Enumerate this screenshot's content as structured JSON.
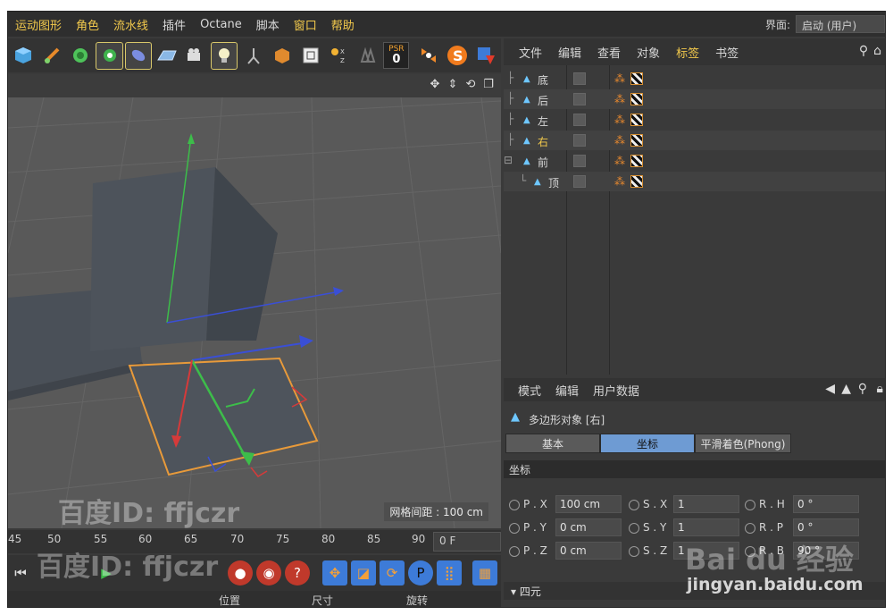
{
  "menubar": {
    "items": [
      "运动图形",
      "角色",
      "流水线",
      "插件",
      "Octane",
      "脚本",
      "窗口",
      "帮助"
    ],
    "layout_label": "界面:",
    "layout_value": "启动 (用户)"
  },
  "toolbar": {
    "psr_top": "PSR",
    "psr_bottom": "0"
  },
  "viewport": {
    "grid_info": "网格间距 : 100 cm"
  },
  "timeline": {
    "ticks": [
      "45",
      "50",
      "55",
      "60",
      "65",
      "70",
      "75",
      "80",
      "85",
      "90"
    ],
    "current_frame": "0 F"
  },
  "bottom_bar": {
    "position": "位置",
    "size": "尺寸",
    "rotation": "旋转"
  },
  "object_manager": {
    "menu": [
      "文件",
      "编辑",
      "查看",
      "对象",
      "标签",
      "书签"
    ],
    "objects": [
      {
        "name": "底",
        "indent": 0,
        "selected": false
      },
      {
        "name": "后",
        "indent": 0,
        "selected": false
      },
      {
        "name": "左",
        "indent": 0,
        "selected": false
      },
      {
        "name": "右",
        "indent": 0,
        "selected": true
      },
      {
        "name": "前",
        "indent": 0,
        "selected": false
      },
      {
        "name": "顶",
        "indent": 1,
        "selected": false
      }
    ]
  },
  "attribute_manager": {
    "menu": [
      "模式",
      "编辑",
      "用户数据"
    ],
    "title": "多边形对象 [右]",
    "tabs": [
      "基本",
      "坐标",
      "平滑着色(Phong)"
    ],
    "active_tab": "坐标",
    "section": "坐标",
    "rows": [
      {
        "p_label": "P . X",
        "p_value": "100 cm",
        "s_label": "S . X",
        "s_value": "1",
        "r_label": "R . H",
        "r_value": "0 °"
      },
      {
        "p_label": "P . Y",
        "p_value": "0 cm",
        "s_label": "S . Y",
        "s_value": "1",
        "r_label": "R . P",
        "r_value": "0 °"
      },
      {
        "p_label": "P . Z",
        "p_value": "0 cm",
        "s_label": "S . Z",
        "s_value": "1",
        "r_label": "R . B",
        "r_value": "90 °"
      }
    ],
    "quaternion": "▾ 四元"
  },
  "watermarks": {
    "baidu_id": "百度ID: ffjczr",
    "baidu_logo": "Bai du 经验",
    "url": "jingyan.baidu.com"
  },
  "colors": {
    "accent": "#f2c94c",
    "active_tab": "#6e9bd3",
    "viewport_bg": "#595959"
  }
}
